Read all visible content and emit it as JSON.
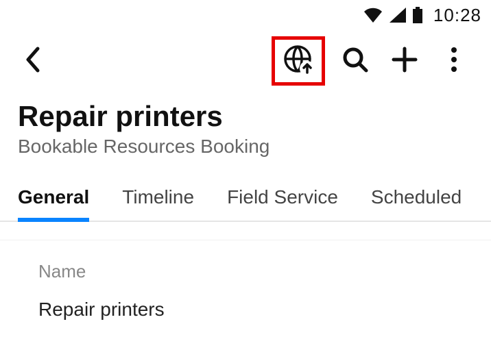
{
  "statusbar": {
    "time": "10:28"
  },
  "header": {
    "title": "Repair printers",
    "subtitle": "Bookable Resources Booking"
  },
  "tabs": [
    {
      "label": "General",
      "active": true
    },
    {
      "label": "Timeline",
      "active": false
    },
    {
      "label": "Field Service",
      "active": false
    },
    {
      "label": "Scheduled",
      "active": false
    }
  ],
  "fields": {
    "name": {
      "label": "Name",
      "value": "Repair printers"
    }
  },
  "icons": {
    "back": "back-icon",
    "globe_upload": "globe-upload-icon",
    "search": "search-icon",
    "add": "add-icon",
    "more": "more-icon",
    "wifi": "wifi-icon",
    "cell": "cell-signal-icon",
    "battery": "battery-icon"
  },
  "highlight": {
    "target": "globe-upload-icon",
    "color": "#e60000"
  }
}
